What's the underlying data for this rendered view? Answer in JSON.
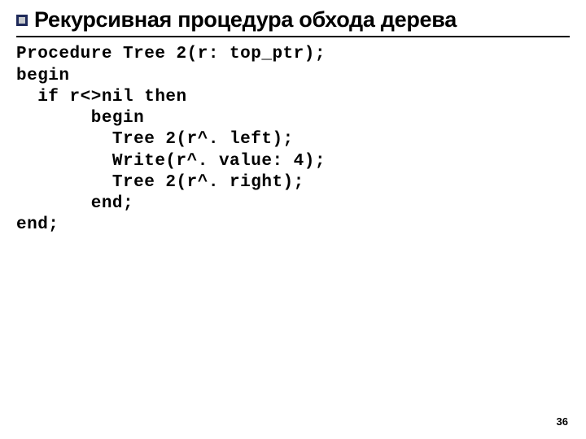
{
  "slide": {
    "title": "Рекурсивная процедура обхода дерева",
    "page_number": "36"
  },
  "code": {
    "l1": "Procedure Tree 2(r: top_ptr);",
    "l2": "begin",
    "l3": "  if r<>nil then",
    "l4": "       begin",
    "l5": "         Tree 2(r^. left);",
    "l6": "         Write(r^. value: 4);",
    "l7": "         Tree 2(r^. right);",
    "l8": "       end;",
    "l9": "end;"
  }
}
